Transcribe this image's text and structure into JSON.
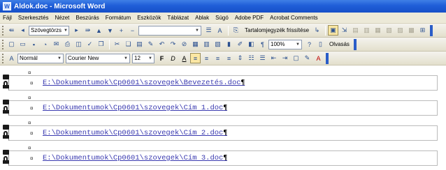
{
  "window": {
    "title": "Aldok.doc - Microsoft Word",
    "app_icon": "W"
  },
  "menu": [
    "Fájl",
    "Szerkesztés",
    "Nézet",
    "Beszúrás",
    "Formátum",
    "Eszközök",
    "Táblázat",
    "Ablak",
    "Súgó",
    "Adobe PDF",
    "Acrobat Comments"
  ],
  "toolbar1": {
    "style_box": "Szövegtörzs",
    "update_toc_label": "Tartalomjegyzék frissítése"
  },
  "toolbar2": {
    "zoom": "100%",
    "read_label": "Olvasás"
  },
  "toolbar3": {
    "style": "Normál",
    "font": "Courier New",
    "size": "12",
    "bold": "F",
    "italic": "D",
    "underline": "A"
  },
  "document": {
    "para_mark": "¤",
    "links": [
      "E:\\Dokumentumok\\Cp0601\\szovegek\\Bevezetés.doc",
      "E:\\Dokumentumok\\Cp0601\\szovegek\\Cím 1.doc",
      "E:\\Dokumentumok\\Cp0601\\szovegek\\Cím 2.doc",
      "E:\\Dokumentumok\\Cp0601\\szovegek\\Cím 3.doc"
    ],
    "pilcrow": "¶"
  },
  "colors": {
    "titlebar": "#1f5ed8",
    "menubar": "#ece9d8",
    "link": "#3a3ab0"
  }
}
